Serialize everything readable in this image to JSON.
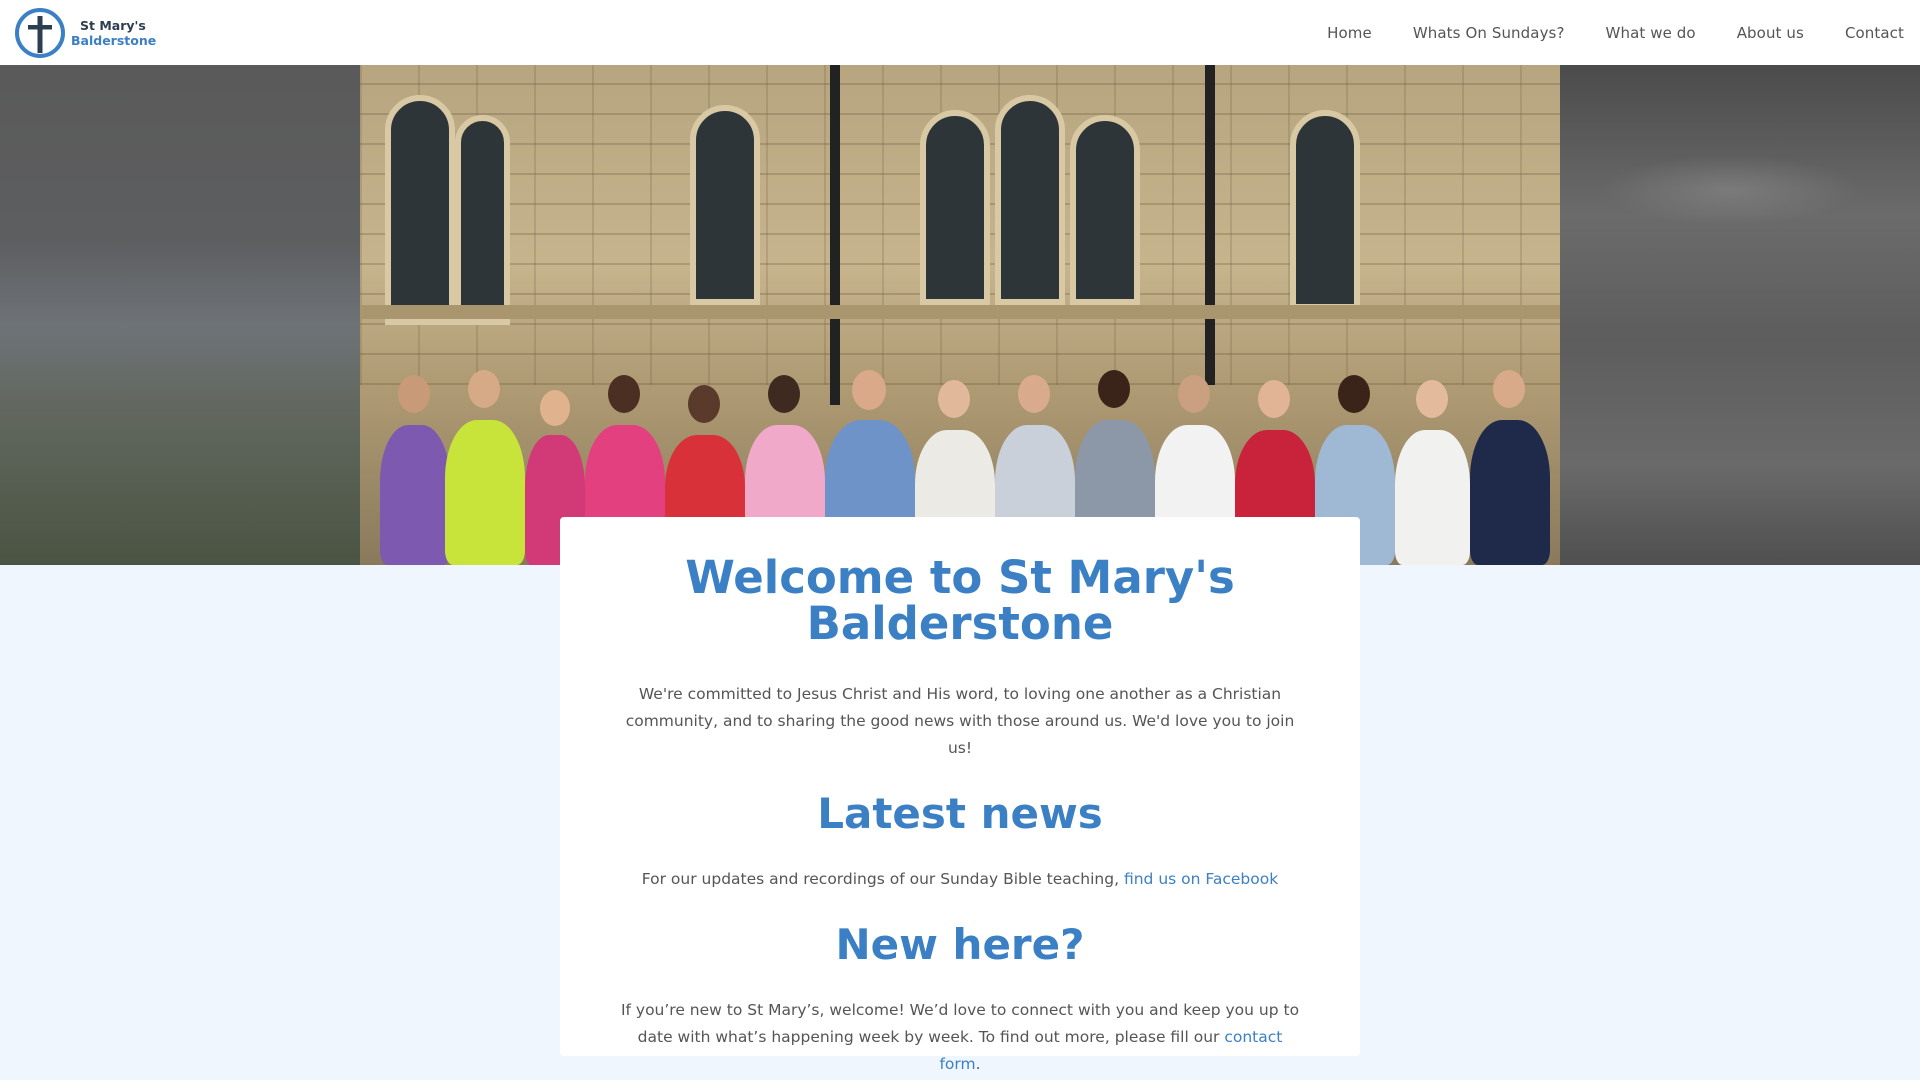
{
  "site": {
    "logo_line1": "St Mary's",
    "logo_line2": "Balderstone",
    "brand_color": "#3b7fc4",
    "dark_color": "#2d3e50"
  },
  "nav": {
    "items": [
      {
        "label": "Home"
      },
      {
        "label": "Whats On Sundays?"
      },
      {
        "label": "What we do"
      },
      {
        "label": "About us"
      },
      {
        "label": "Contact"
      }
    ]
  },
  "hero": {
    "icon": "church-group-photo"
  },
  "main": {
    "welcome_title": "Welcome to St Mary's Balderstone",
    "welcome_text": "We're committed to Jesus Christ and His word, to loving one another as a Christian community, and to sharing the good news with those around us. We'd love you to join us!",
    "news_title": "Latest news",
    "news_text": "For our updates and recordings of our Sunday Bible teaching,",
    "news_link": "find us on Facebook",
    "new_title": "New here?",
    "new_text": "If you’re new to St Mary’s, welcome! We’d love to connect with you and keep you up to date with what’s happening week by week. To find out more, please fill our",
    "new_link": "contact form",
    "new_text_end": "."
  }
}
